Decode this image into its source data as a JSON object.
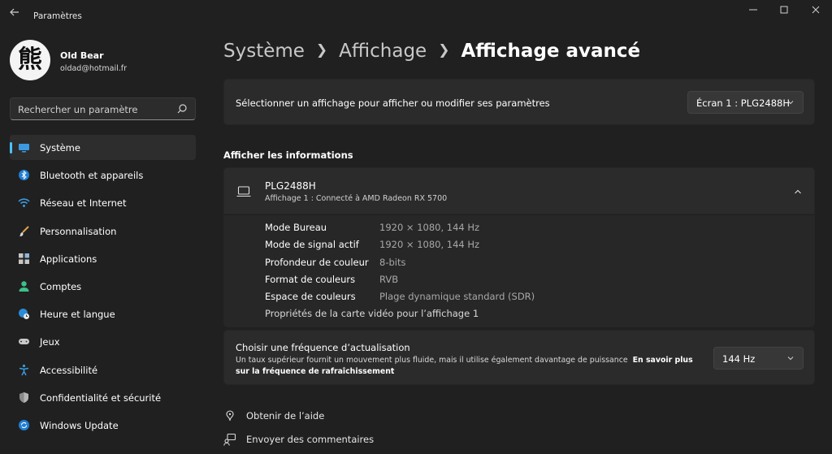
{
  "window": {
    "app_title": "Paramètres",
    "back_icon": "arrow-left-icon",
    "controls": [
      "minimize-icon",
      "maximize-icon",
      "close-icon"
    ]
  },
  "profile": {
    "avatar_glyph": "熊",
    "name": "Old Bear",
    "email": "oldad@hotmail.fr"
  },
  "search": {
    "placeholder": "Rechercher un paramètre",
    "icon": "search-icon"
  },
  "sidebar": {
    "items": [
      {
        "label": "Système",
        "icon": "monitor-icon",
        "selected": true
      },
      {
        "label": "Bluetooth et appareils",
        "icon": "bluetooth-icon"
      },
      {
        "label": "Réseau et Internet",
        "icon": "wifi-icon"
      },
      {
        "label": "Personnalisation",
        "icon": "brush-icon"
      },
      {
        "label": "Applications",
        "icon": "apps-icon"
      },
      {
        "label": "Comptes",
        "icon": "person-icon"
      },
      {
        "label": "Heure et langue",
        "icon": "globe-clock-icon"
      },
      {
        "label": "Jeux",
        "icon": "gamepad-icon"
      },
      {
        "label": "Accessibilité",
        "icon": "accessibility-icon"
      },
      {
        "label": "Confidentialité et sécurité",
        "icon": "shield-icon"
      },
      {
        "label": "Windows Update",
        "icon": "update-icon"
      }
    ]
  },
  "breadcrumb": {
    "level1": "Système",
    "level2": "Affichage",
    "current": "Affichage avancé"
  },
  "display_select": {
    "label": "Sélectionner un affichage pour afficher ou modifier ses paramètres",
    "value": "Écran 1 : PLG2488H"
  },
  "info_section": {
    "title": "Afficher les informations",
    "device_name": "PLG2488H",
    "device_subtitle": "Affichage 1 : Connecté à AMD Radeon RX 5700",
    "rows": [
      {
        "label": "Mode Bureau",
        "value": "1920 × 1080, 144 Hz"
      },
      {
        "label": "Mode de signal actif",
        "value": "1920 × 1080, 144 Hz"
      },
      {
        "label": "Profondeur de couleur",
        "value": "8-bits"
      },
      {
        "label": "Format de couleurs",
        "value": "RVB"
      },
      {
        "label": "Espace de couleurs",
        "value": "Plage dynamique standard (SDR)"
      }
    ],
    "adapter_link": "Propriétés de la carte vidéo pour l’affichage 1"
  },
  "refresh_rate": {
    "title": "Choisir une fréquence d’actualisation",
    "description": "Un taux supérieur fournit un mouvement plus fluide, mais il utilise également davantage de puissance",
    "learn_more": "En savoir plus sur la fréquence de rafraîchissement",
    "value": "144 Hz"
  },
  "footer": {
    "help": "Obtenir de l’aide",
    "feedback": "Envoyer des commentaires"
  },
  "colors": {
    "background": "#202020",
    "card": "#2b2b2b",
    "accent": "#4cc2ff"
  }
}
